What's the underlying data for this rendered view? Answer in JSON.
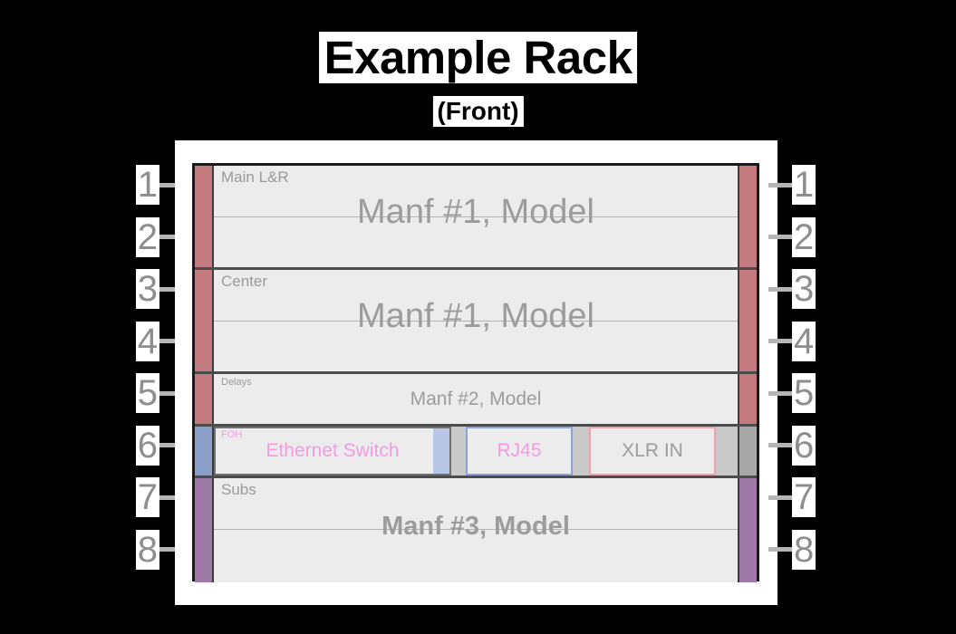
{
  "title": {
    "main": "Example Rack",
    "sub": "(Front)"
  },
  "colors": {
    "rail_red": "#c47b80",
    "rail_blue": "#8ba0c8",
    "rail_purple": "#9f79a8",
    "rail_gray": "#a8a8a8",
    "panel_bg": "#ececec",
    "frame": "#1a1a1a",
    "divider": "#4c4c4c",
    "label_gray": "#9a9a9a",
    "accent_pink": "#f49ae4",
    "border_blue": "#8ba0dd",
    "border_pink": "#efa0a9",
    "unit_number": "#8e8e8e",
    "tick": "#b5b5b5",
    "title_text": "#000000",
    "title_bg": "#ffffff"
  },
  "unit_scale": {
    "left_units": [
      "1",
      "2",
      "3",
      "4",
      "5",
      "6",
      "7",
      "8"
    ],
    "right_units": [
      "1",
      "2",
      "3",
      "4",
      "5",
      "6",
      "7",
      "8"
    ]
  },
  "rack": {
    "rows": [
      {
        "id": "main-lr",
        "label": "Main L&R",
        "label_size": "lg",
        "device": "Manf #1, Model",
        "device_style": "big",
        "rail_left": "#c47b80",
        "rail_right": "#c47b80",
        "units": 2
      },
      {
        "id": "center",
        "label": "Center",
        "label_size": "lg",
        "device": "Manf #1, Model",
        "device_style": "big",
        "rail_left": "#c47b80",
        "rail_right": "#c47b80",
        "units": 2
      },
      {
        "id": "delays",
        "label": "Delays",
        "label_size": "sm",
        "device": "Manf #2, Model",
        "device_style": "mid",
        "rail_left": "#c47b80",
        "rail_right": "#c47b80",
        "units": 1
      },
      {
        "id": "foh",
        "label": "FOH",
        "label_size": "sm",
        "label_color": "pink",
        "rail_left": "#8ba0c8",
        "rail_right": "#a8a8a8",
        "units": 1,
        "devices": [
          {
            "id": "ethernet-switch",
            "text": "Ethernet Switch",
            "text_color": "#f49ae4",
            "border": "#6f6f6f",
            "swatch": "#b8c6e8"
          },
          {
            "id": "rj45",
            "text": "RJ45",
            "text_color": "#f49ae4",
            "border": "#8ba0dd"
          },
          {
            "id": "xlr-in",
            "text": "XLR IN",
            "text_color": "#9c9c9c",
            "border": "#efa0a9"
          }
        ]
      },
      {
        "id": "subs",
        "label": "Subs",
        "label_size": "lg",
        "device": "Manf #3, Model",
        "device_style": "bold",
        "rail_left": "#9f79a8",
        "rail_right": "#9f79a8",
        "units": 2
      }
    ]
  }
}
